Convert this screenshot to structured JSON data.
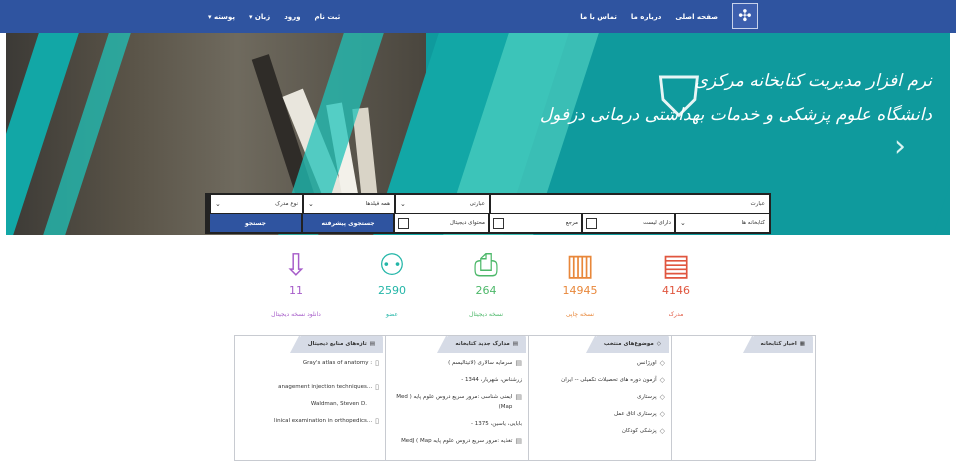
{
  "topbar": {
    "nav_right": [
      "صفحه اصلی",
      "درباره ما",
      "تماس با ما"
    ],
    "nav_left": [
      "ثبت نام",
      "ورود",
      "زبان ▾",
      "پوسته ▾"
    ]
  },
  "hero": {
    "title_line1": "نرم افزار مدیریت کتابخانه مرکزی",
    "title_line2": "دانشگاه علوم پزشکی و خدمات بهداشتی درمانی دزفول"
  },
  "search": {
    "query_placeholder": "عبارت",
    "match_mode": "عبارتی",
    "fields": "همه فیلدها",
    "doc_type": "نوع مدرک",
    "libraries": "کتابخانه ها",
    "chk_has_list": "دارای لیست",
    "chk_reference": "مرجع",
    "chk_digital": "محتوای دیجیتال",
    "advanced_button": "جستجوی پیشرفته",
    "search_button": "جستجو"
  },
  "stats": [
    {
      "num": "4146",
      "label": "مدرک",
      "color": "#e0563f",
      "icon": "book-icon"
    },
    {
      "num": "14945",
      "label": "نسخه چاپی",
      "color": "#e8873a",
      "icon": "library-icon"
    },
    {
      "num": "264",
      "label": "نسخه دیجیتال",
      "color": "#4db86a",
      "icon": "pdf-icon"
    },
    {
      "num": "2590",
      "label": "عضو",
      "color": "#24b6a8",
      "icon": "users-icon"
    },
    {
      "num": "11",
      "label": "دانلود نسخه دیجیتال",
      "color": "#a65cc9",
      "icon": "download-icon"
    }
  ],
  "panels": {
    "news": {
      "title": "اخبار کتابخانه"
    },
    "topics": {
      "title": "موضوع‌های منتخب",
      "items": [
        "اورژانس",
        "آزمون دوره های تحصیلات تکمیلی -- ایران",
        "پرستاری",
        "پرستاری اتاق عمل",
        "پزشکی کودکان"
      ]
    },
    "new_docs": {
      "title": "مدارک جدید کتابخانه",
      "items": [
        "سرمایه سالاری (لاتیتالیسم )",
        "زرشناس، شهریار، 1344 -",
        "ایمنی شناسی :مرور سریع دروس علوم پایه ( Med Map)",
        "بابایی، یاسین، 1375 -",
        "تغذیه :مرور سریع دروس علوم پایه MedJ ( Map"
      ]
    },
    "digital": {
      "title": "تازه‌های منابع دیجیتال",
      "items": [
        "Gray's atlas of anatomy :",
        "anagement injection techniques...",
        "Waldman, Steven D.",
        "linical examination in orthopedics..."
      ]
    }
  }
}
